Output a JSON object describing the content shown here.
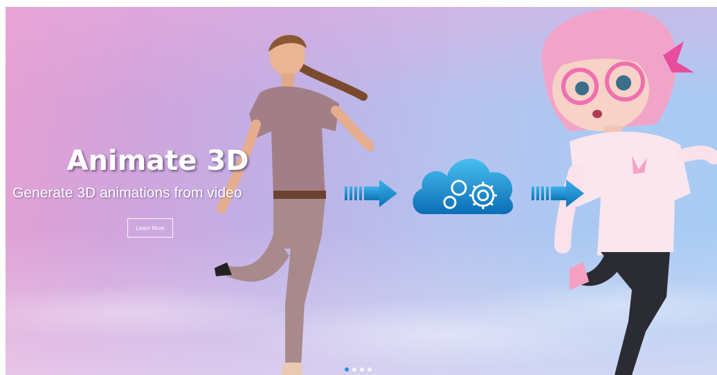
{
  "slide": {
    "title": "Animate 3D",
    "subtitle": "Generate 3D animations from video",
    "cta_label": "Learn More"
  },
  "pipeline": {
    "arrow_icon": "striped-arrow-right",
    "cloud_icon": "cloud-gears-icon",
    "accent_color": "#1d8fd0"
  },
  "carousel": {
    "total_slides": 4,
    "active_index": 0
  },
  "figures": {
    "real_person": "photo of woman dancing",
    "cartoon": "3D cartoon girl with pink hair and glasses"
  },
  "colors": {
    "sky_left": "#e6a0d2",
    "sky_right": "#a9cdf4",
    "text": "#ffffff"
  }
}
